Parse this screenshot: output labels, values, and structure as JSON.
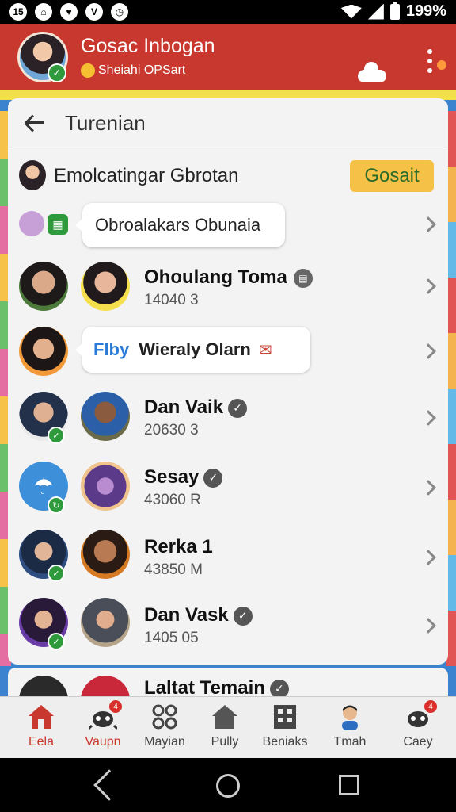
{
  "status_bar": {
    "time": "199%",
    "icons": [
      "15",
      "home-icon",
      "heart-icon",
      "v-icon",
      "clock-icon"
    ]
  },
  "app_bar": {
    "title": "Gosac Inbogan",
    "subtitle": "Sheiahi OPSart",
    "colors": {
      "background": "#c8382e"
    }
  },
  "panel": {
    "title": "Turenian",
    "group": {
      "name": "Emolcatingar Gbrotan",
      "button": "Gosait"
    }
  },
  "list": [
    {
      "type": "bubble",
      "text": "Obroalakars Obunaia"
    },
    {
      "type": "contact",
      "name": "Ohoulang Toma",
      "detail": "14040 3",
      "icon": "message-icon"
    },
    {
      "type": "bubble",
      "prefix": "Flby",
      "text": "Wieraly Olarn"
    },
    {
      "type": "contact",
      "name": "Dan Vaik",
      "detail": "20630 3",
      "icon": "verified-icon"
    },
    {
      "type": "contact",
      "name": "Sesay",
      "detail": "43060 R",
      "icon": "verified-icon"
    },
    {
      "type": "contact",
      "name": "Rerka 1",
      "detail": "43850 M",
      "icon": ""
    },
    {
      "type": "contact",
      "name": "Dan Vask",
      "detail": "1405 05",
      "icon": "verified-icon"
    }
  ],
  "peek_row": {
    "name": "Laltat Temain"
  },
  "bottom_nav": [
    {
      "label": "Eela",
      "icon": "home-icon",
      "active": true
    },
    {
      "label": "Vaupn",
      "icon": "bug-icon",
      "active": true,
      "badge": "4"
    },
    {
      "label": "Mayian",
      "icon": "grid-circles-icon"
    },
    {
      "label": "Pully",
      "icon": "house-icon"
    },
    {
      "label": "Beniaks",
      "icon": "building-icon"
    },
    {
      "label": "Tmah",
      "icon": "person-icon"
    },
    {
      "label": "Caey",
      "icon": "bug-icon",
      "badge": "4"
    }
  ],
  "theme": {
    "accent": "#c8382e",
    "button_yellow": "#f5c247",
    "verified_green": "#2e9a3c"
  }
}
